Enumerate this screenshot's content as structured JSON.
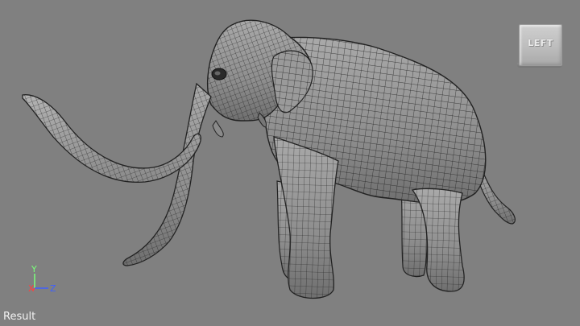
{
  "viewport": {
    "background": "#808080",
    "view_cube": {
      "face_label": "LEFT"
    },
    "axis_gizmo": {
      "y": "Y",
      "x": "X",
      "z": "Z",
      "colors": {
        "x": "#ff3f3f",
        "y": "#7aff7a",
        "z": "#3f5fff"
      }
    },
    "status_label": "Result",
    "model": {
      "name": "mammoth-wireframe-mesh",
      "shading": "smooth-shaded gray with wireframe on shaded"
    }
  }
}
